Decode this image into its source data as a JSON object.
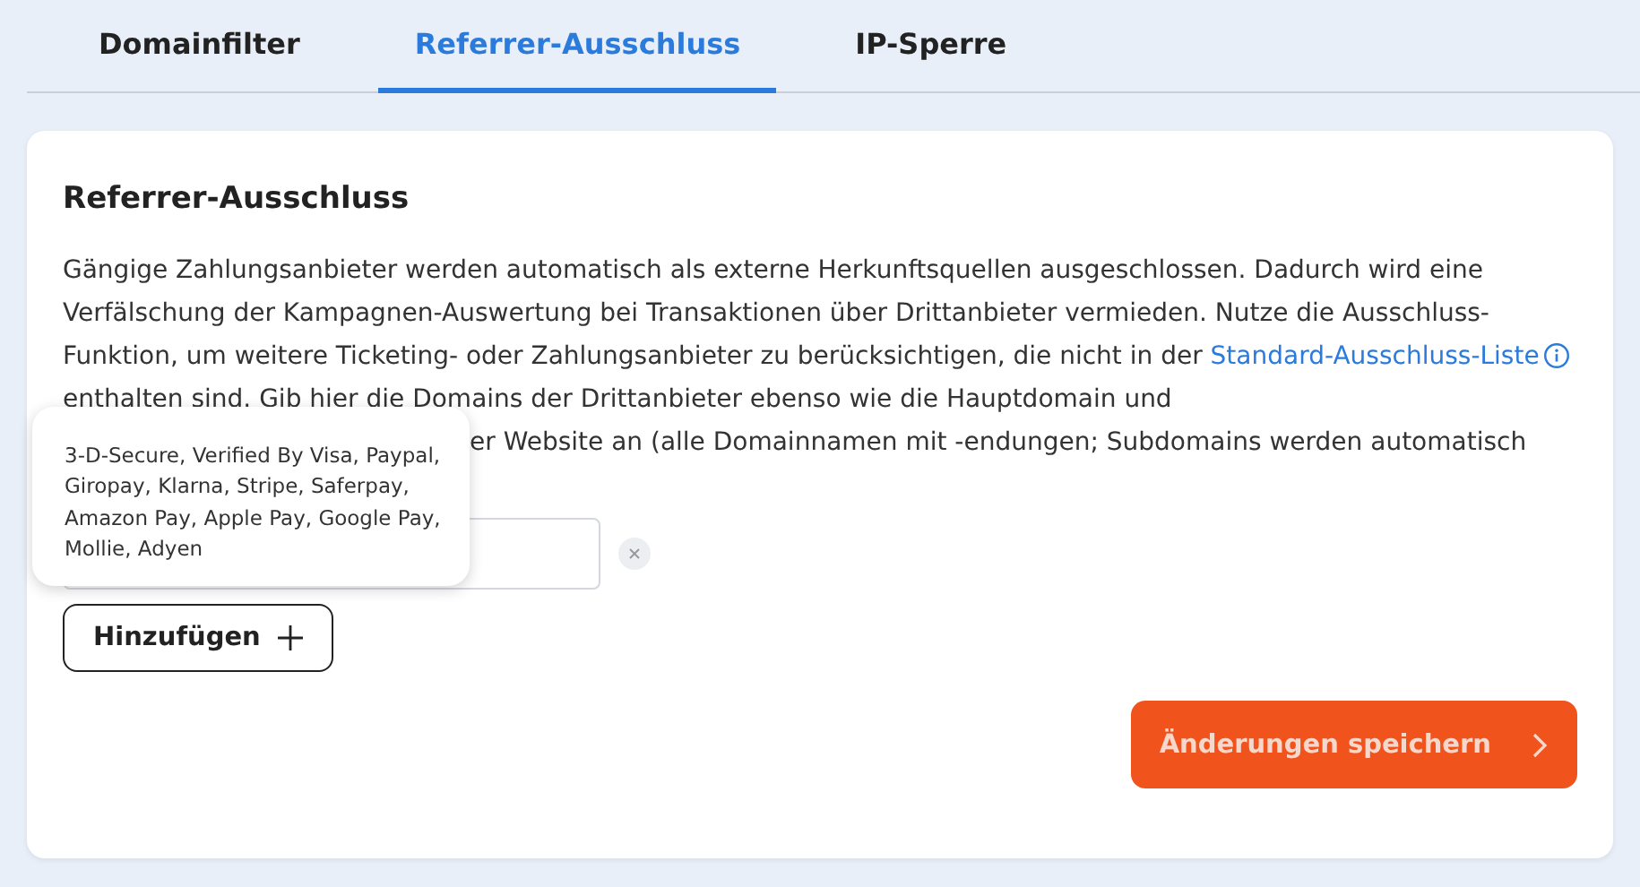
{
  "tabs": [
    {
      "label": "Domainfilter",
      "selected": false
    },
    {
      "label": "Referrer-Ausschluss",
      "selected": true
    },
    {
      "label": "IP-Sperre",
      "selected": false
    }
  ],
  "card": {
    "title": "Referrer-Ausschluss",
    "text_before_link": "Gängige Zahlungsanbieter werden automatisch als externe Herkunftsquellen ausgeschlossen. Dadurch wird eine Verfälschung der Kampagnen-Auswertung bei Transaktionen über Drittanbieter vermieden. Nutze die Ausschluss-Funktion, um weitere Ticketing- oder Zahlungsanbieter zu berücksichtigen, die nicht in der",
    "link": "Standard-Ausschluss-Liste",
    "text_after_link": "enthalten sind. Gib hier die Domains der Drittanbieter ebenso wie die Hauptdomain und",
    "text_partly_covered": "er Website an (alle Domainnamen mit -endungen; Subdomains werden automatisch",
    "tooltip": "3-D-Secure, Verified By Visa, Paypal, Giropay, Klarna, Stripe, Saferpay, Amazon Pay, Apple Pay, Google Pay, Mollie, Adyen",
    "add_button": "Hinzufügen",
    "save_button": "Änderungen speichern"
  }
}
